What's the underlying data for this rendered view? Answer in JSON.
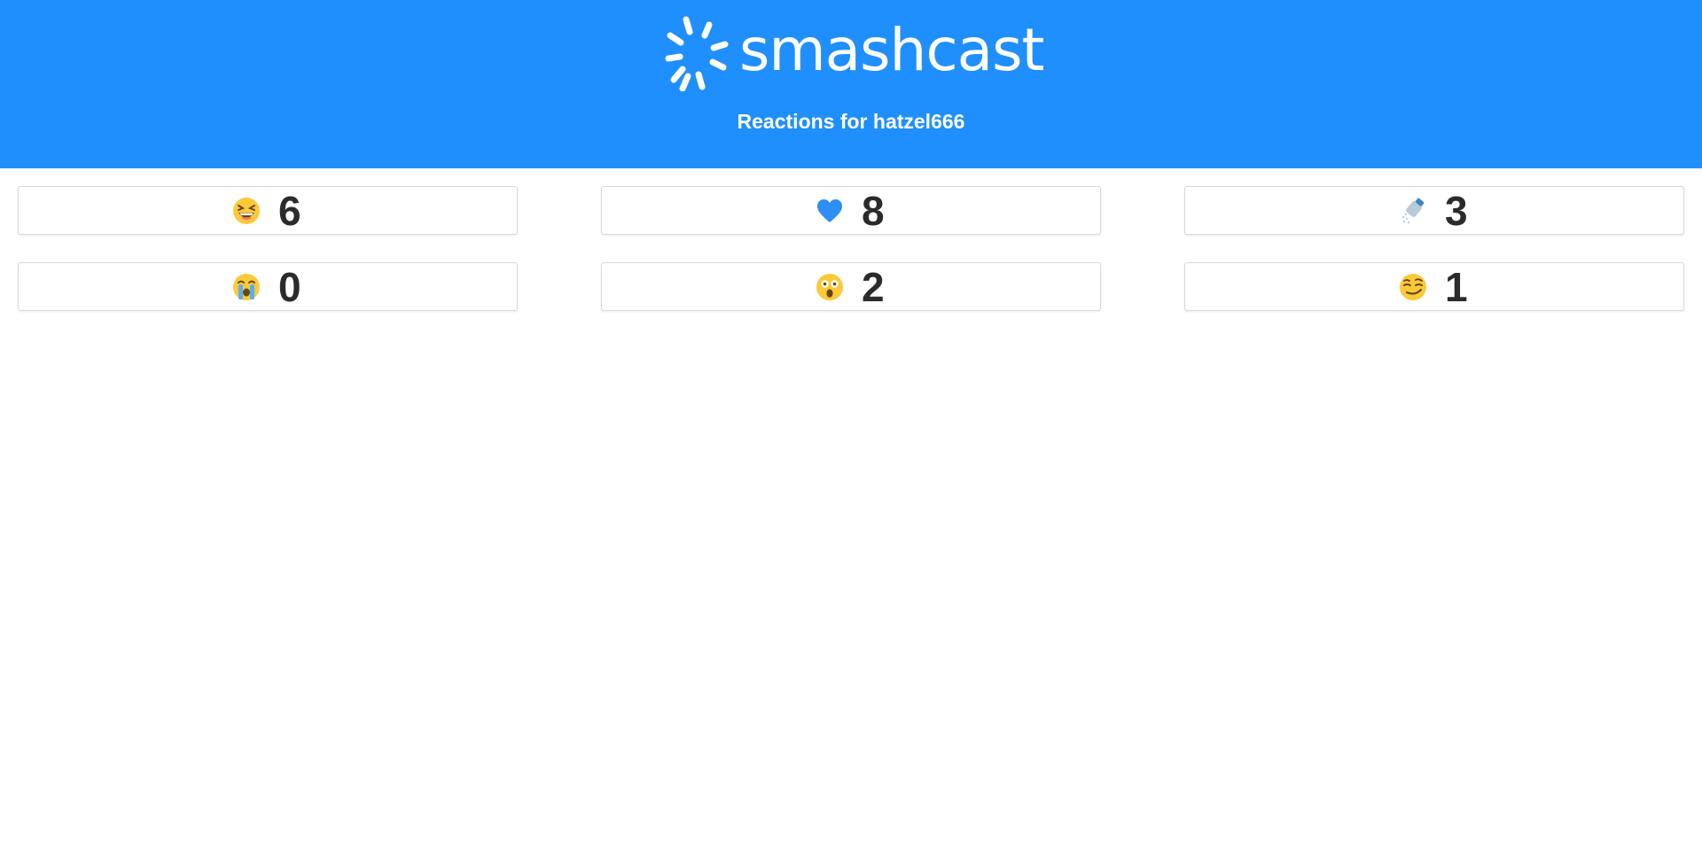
{
  "header": {
    "brand": "smashcast",
    "subtitle": "Reactions for hatzel666",
    "background": "#208ffe"
  },
  "reactions": [
    {
      "icon": "laughing-face-icon",
      "count": "6"
    },
    {
      "icon": "blue-heart-icon",
      "count": "8"
    },
    {
      "icon": "salt-shaker-icon",
      "count": "3"
    },
    {
      "icon": "crying-face-icon",
      "count": "0"
    },
    {
      "icon": "astonished-face-icon",
      "count": "2"
    },
    {
      "icon": "smirking-face-icon",
      "count": "1"
    }
  ]
}
